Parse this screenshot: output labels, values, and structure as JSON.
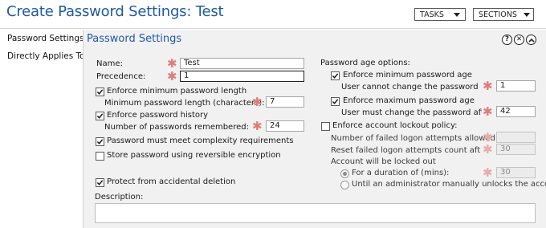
{
  "header": {
    "title": "Create Password Settings: Test",
    "tasks_label": "TASKS",
    "sections_label": "SECTIONS"
  },
  "nav": {
    "items": [
      {
        "label": "Password Settings"
      },
      {
        "label": "Directly Applies To"
      }
    ]
  },
  "panel": {
    "title": "Password Settings",
    "icons": [
      "help-icon",
      "close-icon",
      "collapse-icon"
    ]
  },
  "form": {
    "name_label": "Name:",
    "name_value": "Test",
    "precedence_label": "Precedence:",
    "precedence_value": "1",
    "enforce_min_length_label": "Enforce minimum password length",
    "enforce_min_length_checked": true,
    "min_length_label": "Minimum password length (characters):",
    "min_length_value": "7",
    "enforce_history_label": "Enforce password history",
    "enforce_history_checked": true,
    "history_label": "Number of passwords remembered:",
    "history_value": "24",
    "complexity_label": "Password must meet complexity requirements",
    "complexity_checked": true,
    "reversible_label": "Store password using reversible encryption",
    "reversible_checked": false,
    "protect_label": "Protect from accidental deletion",
    "protect_checked": true,
    "description_label": "Description:"
  },
  "age": {
    "heading": "Password age options:",
    "enforce_min_age_label": "Enforce minimum password age",
    "enforce_min_age_checked": true,
    "min_age_label": "User cannot change the password within...",
    "min_age_value": "1",
    "enforce_max_age_label": "Enforce maximum password age",
    "enforce_max_age_checked": true,
    "max_age_label": "User must change the password after (da...",
    "max_age_value": "42"
  },
  "lockout": {
    "enforce_label": "Enforce account lockout policy:",
    "enforce_checked": false,
    "failed_attempts_label": "Number of failed logon attempts allowed:",
    "failed_attempts_value": "",
    "reset_label": "Reset failed logon attempts count after (mi...",
    "reset_value": "30",
    "locked_out_label": "Account will be locked out",
    "duration_label": "For a duration of (mins):",
    "duration_value": "30",
    "until_admin_label": "Until an administrator manually unlocks the account"
  },
  "colors": {
    "accent": "#1e5aa8",
    "required_asterisk": "#e07b7b",
    "panel_bg": "#f1f1f1"
  }
}
